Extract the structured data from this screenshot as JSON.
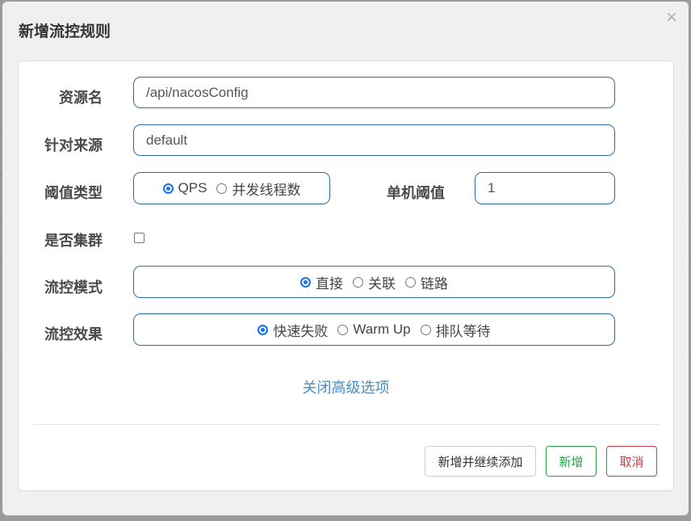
{
  "dialog": {
    "title": "新增流控规则",
    "close_icon": "×"
  },
  "form": {
    "resource_name": {
      "label": "资源名",
      "value": "/api/nacosConfig"
    },
    "limit_app": {
      "label": "针对来源",
      "value": "default"
    },
    "grade": {
      "label": "阈值类型",
      "options": [
        {
          "label": "QPS",
          "checked": true
        },
        {
          "label": "并发线程数",
          "checked": false
        }
      ]
    },
    "count": {
      "label": "单机阈值",
      "value": "1"
    },
    "cluster_mode": {
      "label": "是否集群",
      "checked": false
    },
    "strategy": {
      "label": "流控模式",
      "options": [
        {
          "label": "直接",
          "checked": true
        },
        {
          "label": "关联",
          "checked": false
        },
        {
          "label": "链路",
          "checked": false
        }
      ]
    },
    "control_behavior": {
      "label": "流控效果",
      "options": [
        {
          "label": "快速失败",
          "checked": true
        },
        {
          "label": "Warm Up",
          "checked": false
        },
        {
          "label": "排队等待",
          "checked": false
        }
      ]
    },
    "advanced_toggle": "关闭高级选项"
  },
  "footer": {
    "add_and_continue": "新增并继续添加",
    "add": "新增",
    "cancel": "取消"
  },
  "colors": {
    "primary": "#1a73e8",
    "field_border": "#2c6ea3",
    "link": "#4a8bc2",
    "success": "#28a745",
    "danger": "#dc3545"
  }
}
